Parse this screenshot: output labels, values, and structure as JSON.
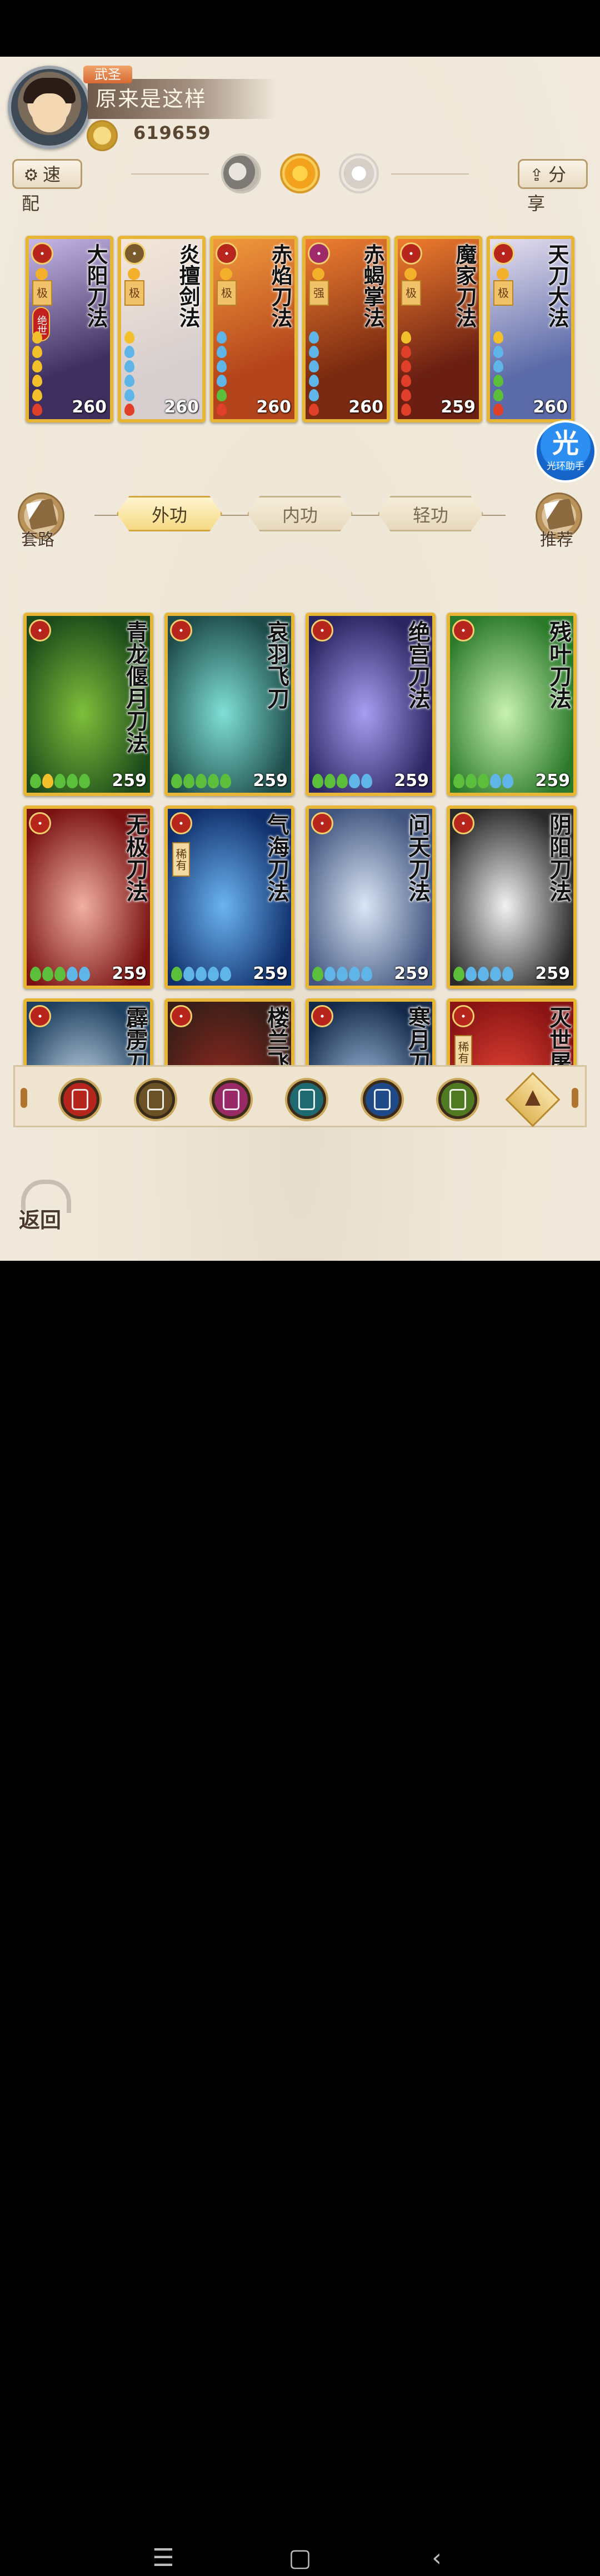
{
  "profile": {
    "rank": "武圣",
    "name": "原来是这样",
    "coins": "619659"
  },
  "top_buttons": {
    "quick_match": "速配",
    "share": "分享"
  },
  "equipped": [
    {
      "title": "大阳刀法",
      "school": "blade",
      "tier": "极",
      "extra": "绝世",
      "level": "260",
      "drops": [
        "gold",
        "gold",
        "gold",
        "gold",
        "gold",
        "red"
      ],
      "bg": "#3f2f5f,#c7b7e8"
    },
    {
      "title": "炎擅剑法",
      "school": "sword",
      "tier": "极",
      "extra": "",
      "level": "260",
      "drops": [
        "gold",
        "blue",
        "blue",
        "blue",
        "blue",
        "red"
      ],
      "bg": "#d7cfcf,#f5e6d8"
    },
    {
      "title": "赤焰刀法",
      "school": "blade",
      "tier": "极",
      "extra": "",
      "level": "260",
      "drops": [
        "blue",
        "blue",
        "blue",
        "blue",
        "green",
        "red"
      ],
      "bg": "#b4441b,#f19a3d"
    },
    {
      "title": "赤蝎掌法",
      "school": "fist",
      "tier": "强",
      "extra": "",
      "level": "260",
      "drops": [
        "blue",
        "blue",
        "blue",
        "blue",
        "blue",
        "red"
      ],
      "bg": "#7a2a10,#f07f32"
    },
    {
      "title": "魔家刀法",
      "school": "blade",
      "tier": "极",
      "extra": "",
      "level": "259",
      "drops": [
        "gold",
        "red",
        "red",
        "red",
        "red",
        "red"
      ],
      "bg": "#6a1f12,#ef7c2e"
    },
    {
      "title": "天刀大法",
      "school": "blade",
      "tier": "极",
      "extra": "",
      "level": "260",
      "drops": [
        "gold",
        "blue",
        "blue",
        "green",
        "green",
        "red"
      ],
      "bg": "#5b6aa8,#e8e0f0"
    }
  ],
  "helper": {
    "big": "光",
    "small": "光环助手"
  },
  "side_left": "套路",
  "side_right": "推荐",
  "tabs": [
    "外功",
    "内功",
    "轻功"
  ],
  "skills": [
    {
      "title": "青龙偃月刀法",
      "level": "259",
      "rare": "",
      "drops": [
        "green",
        "gold",
        "green",
        "green",
        "green"
      ],
      "bg": "#1c4a1a,#7fbf3b"
    },
    {
      "title": "哀羽飞刀",
      "level": "259",
      "rare": "",
      "drops": [
        "green",
        "green",
        "green",
        "green",
        "green"
      ],
      "bg": "#1e4c4a,#7fe0d6"
    },
    {
      "title": "绝宫刀法",
      "level": "259",
      "rare": "",
      "drops": [
        "green",
        "green",
        "green",
        "blue",
        "blue"
      ],
      "bg": "#2a2460,#a89ef2"
    },
    {
      "title": "残叶刀法",
      "level": "259",
      "rare": "",
      "drops": [
        "green",
        "green",
        "green",
        "blue",
        "blue"
      ],
      "bg": "#2b7a2a,#c8f2b0"
    },
    {
      "title": "无极刀法",
      "level": "259",
      "rare": "",
      "drops": [
        "green",
        "green",
        "green",
        "blue",
        "blue"
      ],
      "bg": "#7a1212,#f1b0a0"
    },
    {
      "title": "气海刀法",
      "level": "259",
      "rare": "稀有",
      "drops": [
        "green",
        "blue",
        "blue",
        "blue",
        "blue"
      ],
      "bg": "#0f2e6a,#6bb4f2"
    },
    {
      "title": "问天刀法",
      "level": "259",
      "rare": "",
      "drops": [
        "green",
        "blue",
        "blue",
        "blue",
        "blue"
      ],
      "bg": "#41557f,#dbe6f6"
    },
    {
      "title": "阴阳刀法",
      "level": "259",
      "rare": "",
      "drops": [
        "green",
        "blue",
        "blue",
        "blue",
        "blue"
      ],
      "bg": "#2a2a2a,#f2f2f2"
    },
    {
      "title": "霹雳刀法",
      "level": "",
      "rare": "",
      "drops": [],
      "bg": "#1f4060,#cfe3f2"
    },
    {
      "title": "楼兰飞刀",
      "level": "",
      "rare": "",
      "drops": [],
      "bg": "#3a1e18,#9a2a20"
    },
    {
      "title": "寒月刀法",
      "level": "",
      "rare": "",
      "drops": [],
      "bg": "#152a4a,#a7c6e8"
    },
    {
      "title": "灭世屠刀",
      "level": "",
      "rare": "稀有",
      "drops": [],
      "bg": "#8a1414,#f04a3a"
    }
  ],
  "filters": [
    {
      "name": "blade",
      "color": "#b7261d"
    },
    {
      "name": "sword",
      "color": "#6a5226"
    },
    {
      "name": "fist",
      "color": "#9a2a66"
    },
    {
      "name": "palm",
      "color": "#1f6a70"
    },
    {
      "name": "taichi",
      "color": "#1f4a8a"
    },
    {
      "name": "dragon",
      "color": "#4f7a22"
    }
  ],
  "back": "返回",
  "colors": {
    "card_border": "#e7b636",
    "background": "#f1eadc"
  }
}
